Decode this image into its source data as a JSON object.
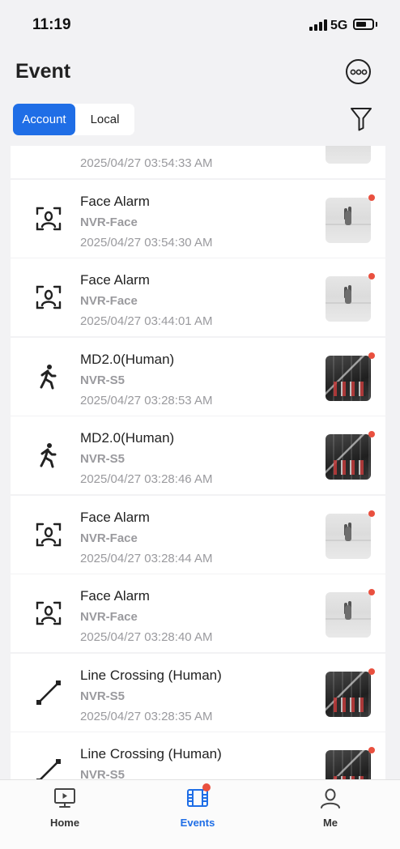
{
  "status_bar": {
    "time": "11:19",
    "network": "5G"
  },
  "header": {
    "title": "Event",
    "more_icon": "more-circle-icon",
    "filter_icon": "filter-icon"
  },
  "segmented": {
    "tabs": [
      "Account",
      "Local"
    ],
    "selected": "Account"
  },
  "events": [
    {
      "title": "",
      "source": "",
      "time": "2025/04/27 03:54:33 AM",
      "icon": "",
      "thumb": "face",
      "unread": false
    },
    {
      "title": "Face Alarm",
      "source": "NVR-Face",
      "time": "2025/04/27 03:54:30 AM",
      "icon": "face-icon",
      "thumb": "face",
      "unread": true
    },
    {
      "title": "Face Alarm",
      "source": "NVR-Face",
      "time": "2025/04/27 03:44:01 AM",
      "icon": "face-icon",
      "thumb": "face",
      "unread": true
    },
    {
      "title": "MD2.0(Human)",
      "source": "NVR-S5",
      "time": "2025/04/27 03:28:53 AM",
      "icon": "walking-person-icon",
      "thumb": "camera",
      "unread": true
    },
    {
      "title": "MD2.0(Human)",
      "source": "NVR-S5",
      "time": "2025/04/27 03:28:46 AM",
      "icon": "walking-person-icon",
      "thumb": "camera",
      "unread": true
    },
    {
      "title": "Face Alarm",
      "source": "NVR-Face",
      "time": "2025/04/27 03:28:44 AM",
      "icon": "face-icon",
      "thumb": "face",
      "unread": true
    },
    {
      "title": "Face Alarm",
      "source": "NVR-Face",
      "time": "2025/04/27 03:28:40 AM",
      "icon": "face-icon",
      "thumb": "face",
      "unread": true
    },
    {
      "title": "Line Crossing (Human)",
      "source": "NVR-S5",
      "time": "2025/04/27 03:28:35 AM",
      "icon": "line-crossing-icon",
      "thumb": "camera",
      "unread": true
    },
    {
      "title": "Line Crossing (Human)",
      "source": "NVR-S5",
      "time": "",
      "icon": "line-crossing-icon",
      "thumb": "camera",
      "unread": true
    }
  ],
  "tab_bar": {
    "tabs": [
      {
        "label": "Home",
        "icon": "monitor-play-icon",
        "active": false
      },
      {
        "label": "Events",
        "icon": "film-icon",
        "active": true,
        "badge": true
      },
      {
        "label": "Me",
        "icon": "person-icon",
        "active": false
      }
    ]
  },
  "colors": {
    "accent": "#1f6ee6",
    "badge": "#e9503f",
    "secondary_text": "#9a9a9e"
  }
}
